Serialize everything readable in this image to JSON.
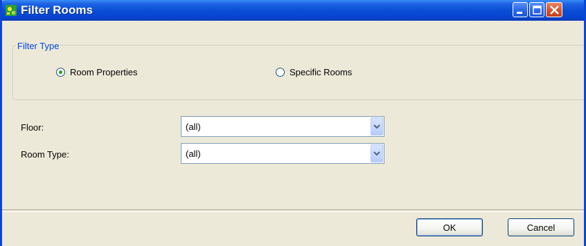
{
  "window": {
    "title": "Filter Rooms",
    "title_icon": "app-icon"
  },
  "filter_type": {
    "legend": "Filter Type",
    "options": [
      {
        "label": "Room Properties",
        "checked": true
      },
      {
        "label": "Specific Rooms",
        "checked": false
      }
    ]
  },
  "fields": {
    "floor": {
      "label": "Floor:",
      "value": "(all)"
    },
    "room_type": {
      "label": "Room Type:",
      "value": "(all)"
    }
  },
  "buttons": {
    "ok": "OK",
    "cancel": "Cancel"
  },
  "colors": {
    "titlebar": "#0a4fd6",
    "legend_text": "#0046d5",
    "radio_dot": "#21a121",
    "close_button": "#d9562c"
  }
}
